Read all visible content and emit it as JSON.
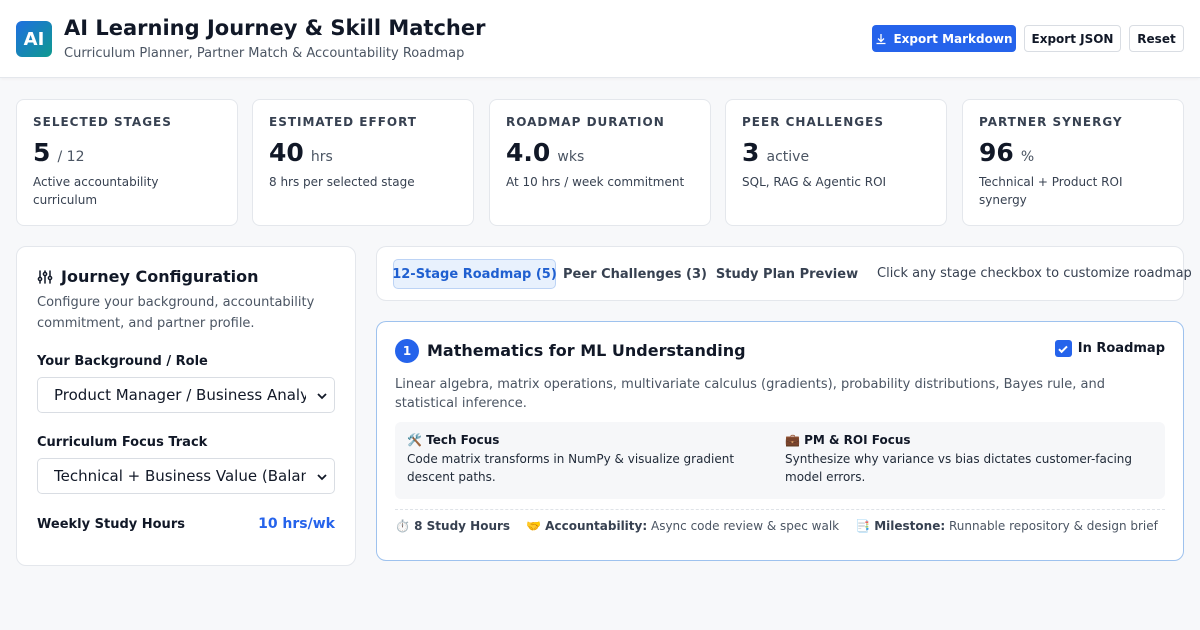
{
  "header": {
    "logo_text": "AI",
    "title": "AI Learning Journey & Skill Matcher",
    "subtitle": "Curriculum Planner, Partner Match & Accountability Roadmap",
    "export_markdown": "Export Markdown",
    "export_json": "Export JSON",
    "reset": "Reset"
  },
  "stats": [
    {
      "label": "SELECTED STAGES",
      "value": "5",
      "unit": "/ 12",
      "desc": "Active accountability curriculum"
    },
    {
      "label": "ESTIMATED EFFORT",
      "value": "40",
      "unit": "hrs",
      "desc": "8 hrs per selected stage"
    },
    {
      "label": "ROADMAP DURATION",
      "value": "4.0",
      "unit": "wks",
      "desc": "At 10 hrs / week commitment"
    },
    {
      "label": "PEER CHALLENGES",
      "value": "3",
      "unit": "active",
      "desc": "SQL, RAG & Agentic ROI"
    },
    {
      "label": "PARTNER SYNERGY",
      "value": "96",
      "unit": "%",
      "desc": "Technical + Product ROI synergy"
    }
  ],
  "config": {
    "title": "Journey Configuration",
    "desc": "Configure your background, accountability commitment, and partner profile.",
    "role_label": "Your Background / Role",
    "role_value": "Product Manager / Business Analyst",
    "track_label": "Curriculum Focus Track",
    "track_value": "Technical + Business Value (Balanced)",
    "hours_label": "Weekly Study Hours",
    "hours_value": "10 hrs/wk"
  },
  "tabs": {
    "roadmap": "12-Stage Roadmap (5)",
    "challenges": "Peer Challenges (3)",
    "preview": "Study Plan Preview",
    "hint": "Click any stage checkbox to customize roadmap"
  },
  "stage": {
    "number": "1",
    "title": "Mathematics for ML Understanding",
    "in_roadmap": "In Roadmap",
    "desc": "Linear algebra, matrix operations, multivariate calculus (gradients), probability distributions, Bayes rule, and statistical inference.",
    "tech_title": "🛠️ Tech Focus",
    "tech_text": "Code matrix transforms in NumPy & visualize gradient descent paths.",
    "pm_title": "💼 PM & ROI Focus",
    "pm_text": "Synthesize why variance vs bias dictates customer-facing model errors.",
    "hours": "⏱️ 8 Study Hours",
    "accountability_label": "🤝 Accountability:",
    "accountability_text": "Async code review & spec walk",
    "milestone_label": "📑 Milestone:",
    "milestone_text": "Runnable repository & design brief"
  },
  "colors": {
    "accent": "#2563eb",
    "logo_gradient_start": "#1f6fe0",
    "logo_gradient_end": "#0f9a8f"
  }
}
